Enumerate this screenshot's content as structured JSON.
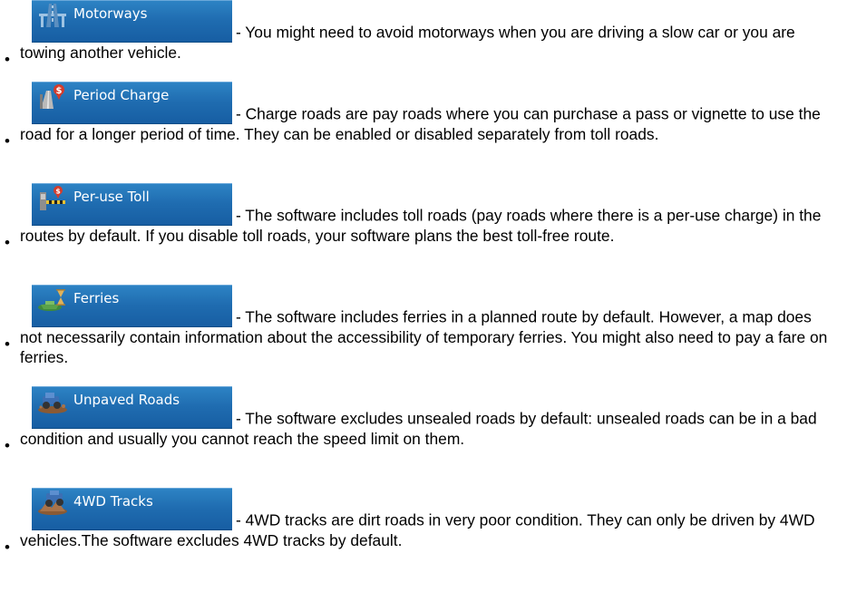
{
  "bullet_char": "•",
  "items": [
    {
      "label": "Motorways",
      "icon": "motorway-icon",
      "desc": "- You might need to avoid motorways when you are driving a slow car or you are towing another vehicle."
    },
    {
      "label": "Period Charge",
      "icon": "period-charge-icon",
      "desc": "- Charge roads are pay roads where you can purchase a pass or vignette to use the road for a longer period of time. They can be enabled or disabled separately from toll roads."
    },
    {
      "label": "Per-use Toll",
      "icon": "per-use-toll-icon",
      "desc": "- The software includes toll roads (pay roads where there is a per-use charge) in the routes by default. If you disable toll roads, your software plans the best toll-free route."
    },
    {
      "label": "Ferries",
      "icon": "ferry-icon",
      "desc": "- The software includes ferries in a planned route by default. However, a map does not necessarily contain information about the accessibility of temporary ferries. You might also need to pay a fare on ferries."
    },
    {
      "label": "Unpaved Roads",
      "icon": "unpaved-road-icon",
      "desc": "- The software excludes unsealed roads by default: unsealed roads can be in a bad condition and usually you cannot reach the speed limit on them."
    },
    {
      "label": "4WD Tracks",
      "icon": "4wd-track-icon",
      "desc": "-  4WD tracks are dirt roads in very poor condition. They can only be driven by 4WD vehicles.The software excludes 4WD tracks by default."
    }
  ],
  "colors": {
    "button_bg": "#1f6cb0",
    "button_text": "#ffffff",
    "body_text": "#000000"
  }
}
